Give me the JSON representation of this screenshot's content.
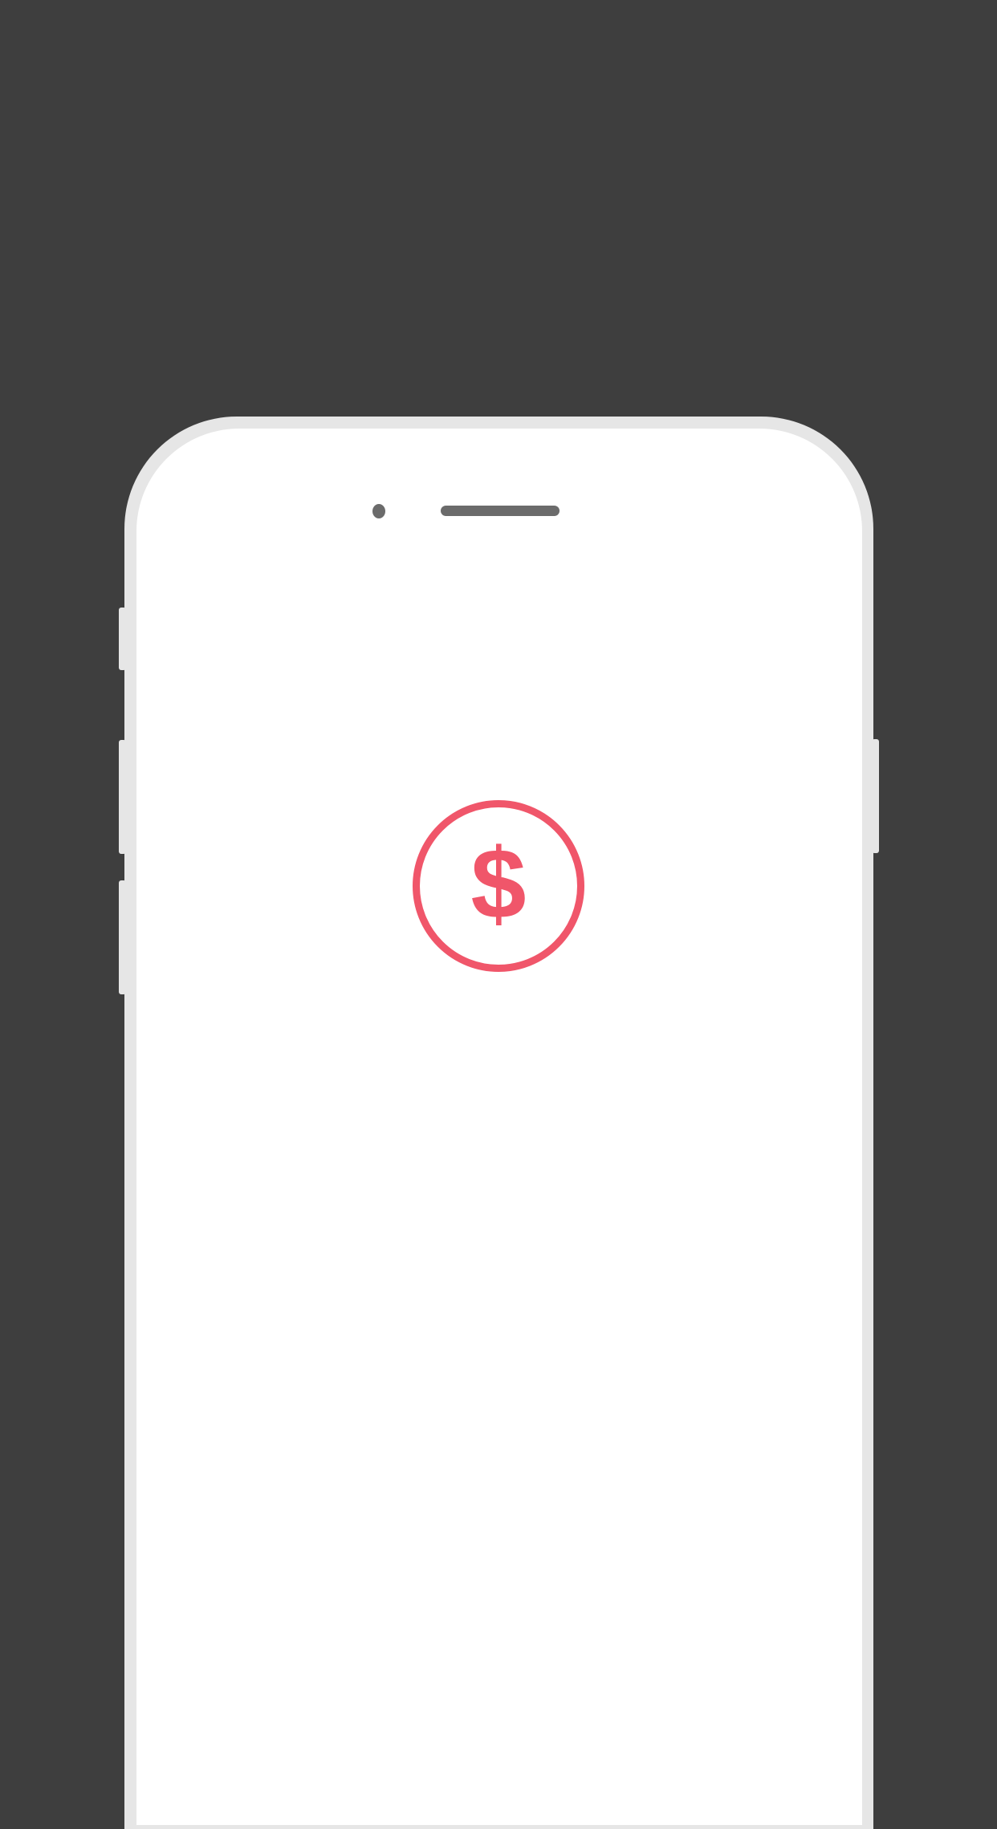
{
  "background_color": "#3e3e3e",
  "device": {
    "frame_color": "#e6e6e6",
    "screen_color": "#ffffff"
  },
  "screen": {
    "icon": {
      "name": "dollar-circle-icon",
      "glyph": "$",
      "color": "#f0566a"
    }
  }
}
